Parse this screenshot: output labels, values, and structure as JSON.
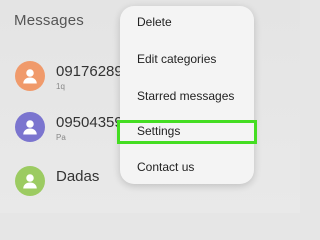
{
  "header": {
    "title": "Messages"
  },
  "conversations": [
    {
      "name": "09176289",
      "preview": "1q",
      "avatar_color": "#f09a6b"
    },
    {
      "name": "09504359",
      "preview": "Pa",
      "avatar_color": "#7b75cf"
    },
    {
      "name": "Dadas",
      "preview": "",
      "avatar_color": "#9ccb62"
    }
  ],
  "menu": {
    "items": [
      {
        "label": "Delete"
      },
      {
        "label": "Edit categories"
      },
      {
        "label": "Starred messages"
      },
      {
        "label": "Settings"
      },
      {
        "label": "Contact us"
      }
    ],
    "highlighted": "Settings",
    "highlight_color": "#44dd22"
  }
}
